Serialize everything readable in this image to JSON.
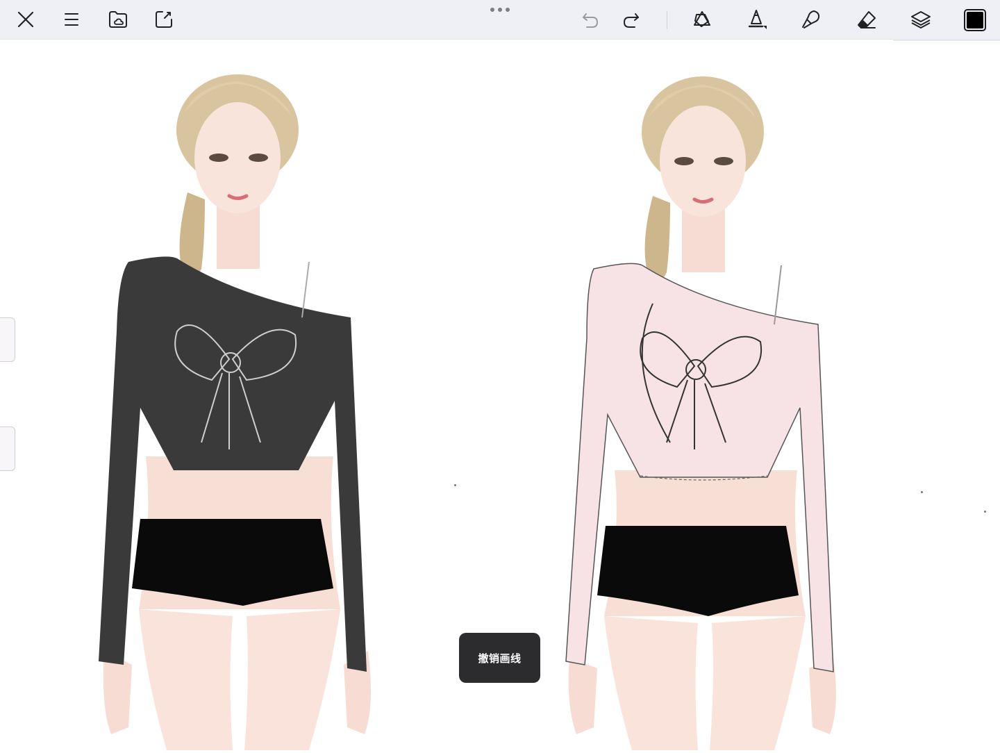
{
  "toolbar": {
    "close_icon": "close-icon",
    "menu_icon": "hamburger-menu-icon",
    "gallery_icon": "folder-cloud-icon",
    "adjust_icon": "share-edit-icon",
    "more_icon": "more-dots-icon",
    "undo_icon": "undo-arrow-icon",
    "redo_icon": "redo-arrow-icon",
    "tools": [
      {
        "name": "shapes-tool",
        "icon": "shapes-icon"
      },
      {
        "name": "brush-tool",
        "icon": "brush-icon"
      },
      {
        "name": "smudge-tool",
        "icon": "smudge-icon"
      },
      {
        "name": "eraser-tool",
        "icon": "eraser-icon"
      },
      {
        "name": "layers-tool",
        "icon": "layers-icon"
      }
    ],
    "current_color": "#000000"
  },
  "canvas": {
    "figures": [
      {
        "name": "dark-top-figure",
        "top_color": "#3a3a3a",
        "bottoms_color": "#0a0a0a"
      },
      {
        "name": "pink-top-figure",
        "top_color": "#f7e3e6",
        "bottoms_color": "#0a0a0a"
      }
    ]
  },
  "toast": {
    "message": "撤销画线"
  }
}
